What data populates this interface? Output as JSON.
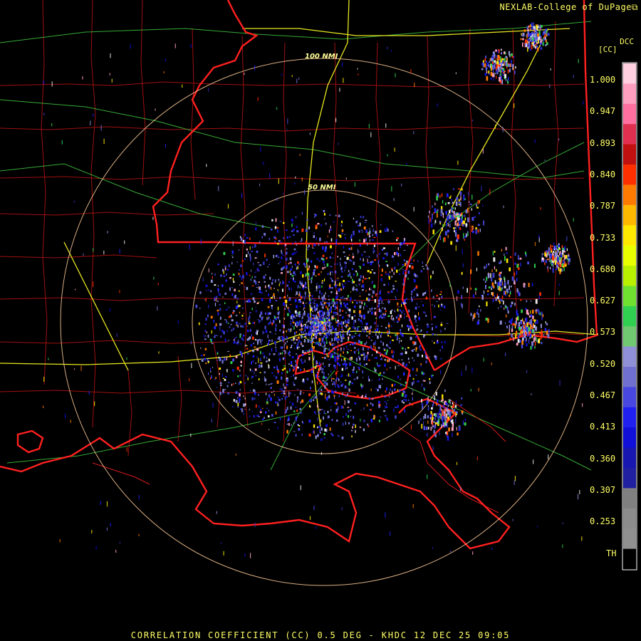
{
  "credit": "NEXLAB-College of DuPage",
  "credit_icon": "external-link-icon",
  "product_code": "DCC",
  "unit_label": "[CC]",
  "range_rings": [
    "100 NMI",
    "50 NMI"
  ],
  "color_scale": {
    "labels": [
      "1.000",
      "0.947",
      "0.893",
      "0.840",
      "0.787",
      "0.733",
      "0.680",
      "0.627",
      "0.573",
      "0.520",
      "0.467",
      "0.413",
      "0.360",
      "0.307",
      "0.253",
      "TH"
    ],
    "colors": [
      "#ffd0e0",
      "#ff9fc0",
      "#ff6f9f",
      "#e03050",
      "#c01010",
      "#ff3000",
      "#ff7a00",
      "#ffb800",
      "#ffe800",
      "#e8ff00",
      "#b8f000",
      "#70e030",
      "#30d050",
      "#70c870",
      "#9090d8",
      "#7070d0",
      "#4848e0",
      "#2020f0",
      "#1010d8",
      "#1818b0",
      "#2020a0",
      "#808080",
      "#8c8c8c",
      "#909090",
      "#000000"
    ]
  },
  "caption": "CORRELATION COEFFICIENT (CC) 0.5 DEG - KHDC 12 DEC 25 09:05"
}
